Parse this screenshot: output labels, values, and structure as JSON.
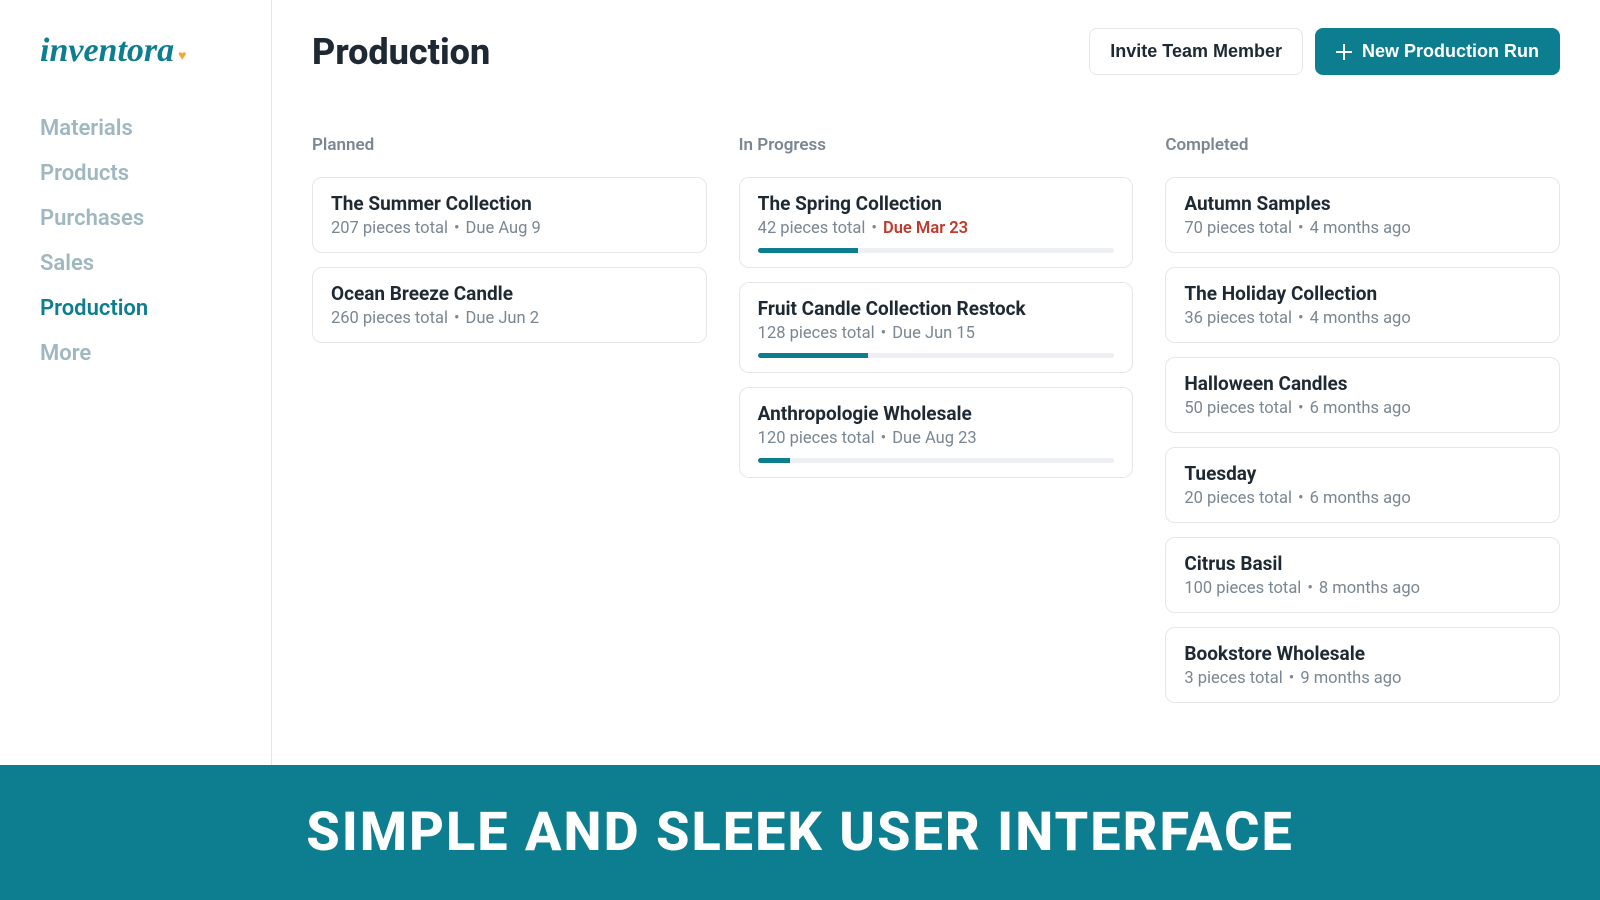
{
  "brand": {
    "name": "inventora"
  },
  "sidebar": {
    "items": [
      {
        "label": "Materials",
        "active": false
      },
      {
        "label": "Products",
        "active": false
      },
      {
        "label": "Purchases",
        "active": false
      },
      {
        "label": "Sales",
        "active": false
      },
      {
        "label": "Production",
        "active": true
      },
      {
        "label": "More",
        "active": false
      }
    ]
  },
  "header": {
    "title": "Production",
    "invite_label": "Invite Team Member",
    "new_run_label": "New Production Run"
  },
  "columns": {
    "planned": {
      "header": "Planned",
      "cards": [
        {
          "title": "The Summer Collection",
          "meta": "207 pieces total",
          "due": "Due Aug 9"
        },
        {
          "title": "Ocean Breeze Candle",
          "meta": "260 pieces total",
          "due": "Due Jun 2"
        }
      ]
    },
    "in_progress": {
      "header": "In Progress",
      "cards": [
        {
          "title": "The Spring Collection",
          "meta": "42 pieces total",
          "due": "Due Mar 23",
          "overdue": true,
          "progress": 28
        },
        {
          "title": "Fruit Candle Collection Restock",
          "meta": "128 pieces total",
          "due": "Due Jun 15",
          "overdue": false,
          "progress": 31
        },
        {
          "title": "Anthropologie Wholesale",
          "meta": "120 pieces total",
          "due": "Due Aug 23",
          "overdue": false,
          "progress": 9
        }
      ]
    },
    "completed": {
      "header": "Completed",
      "cards": [
        {
          "title": "Autumn Samples",
          "meta": "70 pieces total",
          "ago": "4 months ago"
        },
        {
          "title": "The Holiday Collection",
          "meta": "36 pieces total",
          "ago": "4 months ago"
        },
        {
          "title": "Halloween Candles",
          "meta": "50 pieces total",
          "ago": "6 months ago"
        },
        {
          "title": "Tuesday",
          "meta": "20 pieces total",
          "ago": "6 months ago"
        },
        {
          "title": "Citrus Basil",
          "meta": "100 pieces total",
          "ago": "8 months ago"
        },
        {
          "title": "Bookstore Wholesale",
          "meta": "3 pieces total",
          "ago": "9 months ago"
        }
      ]
    }
  },
  "banner": {
    "text": "SIMPLE AND SLEEK USER INTERFACE"
  },
  "colors": {
    "accent": "#0d7e8f",
    "muted": "#7a8691",
    "danger": "#c0392b"
  }
}
